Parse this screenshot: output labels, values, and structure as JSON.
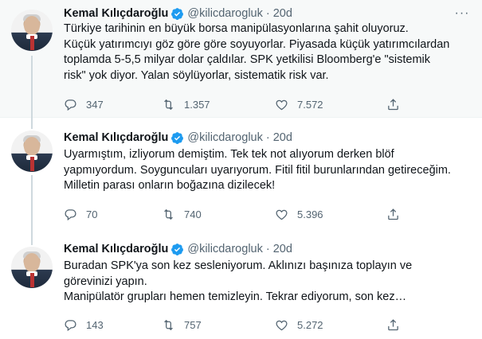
{
  "colors": {
    "verified": "#1d9bf0",
    "muted": "#536471",
    "text": "#0f1419",
    "thread_line": "#cfd9de"
  },
  "tweets": [
    {
      "name": "Kemal Kılıçdaroğlu",
      "handle": "@kilicdarogluk",
      "dot": "·",
      "time": "20d",
      "text": "Türkiye tarihinin en büyük borsa manipülasyonlarına şahit oluyoruz.\nKüçük yatırımcıyı göz göre göre soyuyorlar. Piyasada küçük yatırımcılardan\ntoplamda 5-5,5 milyar dolar çaldılar. SPK yetkilisi Bloomberg'e \"sistemik\nrisk\" yok diyor. Yalan söylüyorlar, sistematik risk var.",
      "replies": "347",
      "retweets": "1.357",
      "likes": "7.572"
    },
    {
      "name": "Kemal Kılıçdaroğlu",
      "handle": "@kilicdarogluk",
      "dot": "·",
      "time": "20d",
      "text": "Uyarmıştım, izliyorum demiştim. Tek tek not alıyorum derken blöf\nyapmıyordum. Soyguncuları uyarıyorum. Fitil fitil burunlarından getireceğim.\nMilletin parası onların boğazına dizilecek!",
      "replies": "70",
      "retweets": "740",
      "likes": "5.396"
    },
    {
      "name": "Kemal Kılıçdaroğlu",
      "handle": "@kilicdarogluk",
      "dot": "·",
      "time": "20d",
      "text": "Buradan SPK'ya son kez sesleniyorum. Aklınızı başınıza toplayın ve\ngörevinizi yapın.\nManipülatör grupları hemen temizleyin. Tekrar ediyorum, son kez…",
      "replies": "143",
      "retweets": "757",
      "likes": "5.272"
    }
  ],
  "icons": {
    "more": "more-dots-icon",
    "reply": "reply-icon",
    "retweet": "retweet-icon",
    "like": "heart-icon",
    "share": "share-icon",
    "verified": "verified-badge-icon"
  }
}
